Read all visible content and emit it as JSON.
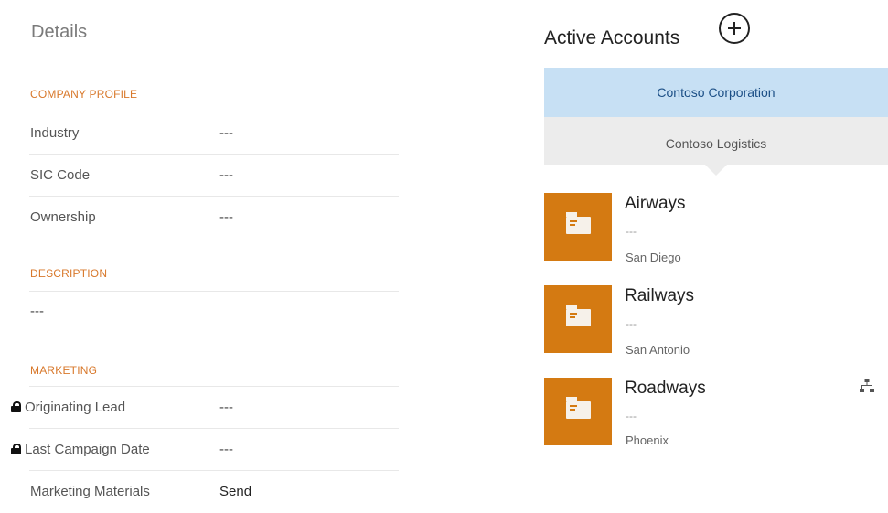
{
  "details": {
    "title": "Details",
    "company_profile": {
      "heading": "COMPANY PROFILE",
      "fields": [
        {
          "label": "Industry",
          "value": "---"
        },
        {
          "label": "SIC Code",
          "value": "---"
        },
        {
          "label": "Ownership",
          "value": "---"
        }
      ]
    },
    "description": {
      "heading": "DESCRIPTION",
      "value": "---"
    },
    "marketing": {
      "heading": "MARKETING",
      "fields": [
        {
          "label": "Originating Lead",
          "value": "---",
          "locked": true
        },
        {
          "label": "Last Campaign Date",
          "value": "---",
          "locked": true
        },
        {
          "label": "Marketing Materials",
          "value": "Send",
          "locked": false
        }
      ]
    }
  },
  "active_accounts": {
    "title": "Active Accounts",
    "add_icon": "plus-circle-icon",
    "selector": [
      {
        "label": "Contoso Corporation",
        "active": true
      },
      {
        "label": "Contoso Logistics",
        "active": false
      }
    ],
    "accounts": [
      {
        "name": "Airways",
        "sub": "---",
        "city": "San Diego",
        "icon": "account-icon"
      },
      {
        "name": "Railways",
        "sub": "---",
        "city": "San Antonio",
        "icon": "account-icon"
      },
      {
        "name": "Roadways",
        "sub": "---",
        "city": "Phoenix",
        "icon": "account-icon"
      }
    ],
    "hierarchy_icon": "hierarchy-icon"
  },
  "colors": {
    "accent_orange": "#d47a12",
    "section_heading": "#d8782b",
    "selected_tab": "#c7e0f4",
    "unselected_tab": "#ececec"
  }
}
